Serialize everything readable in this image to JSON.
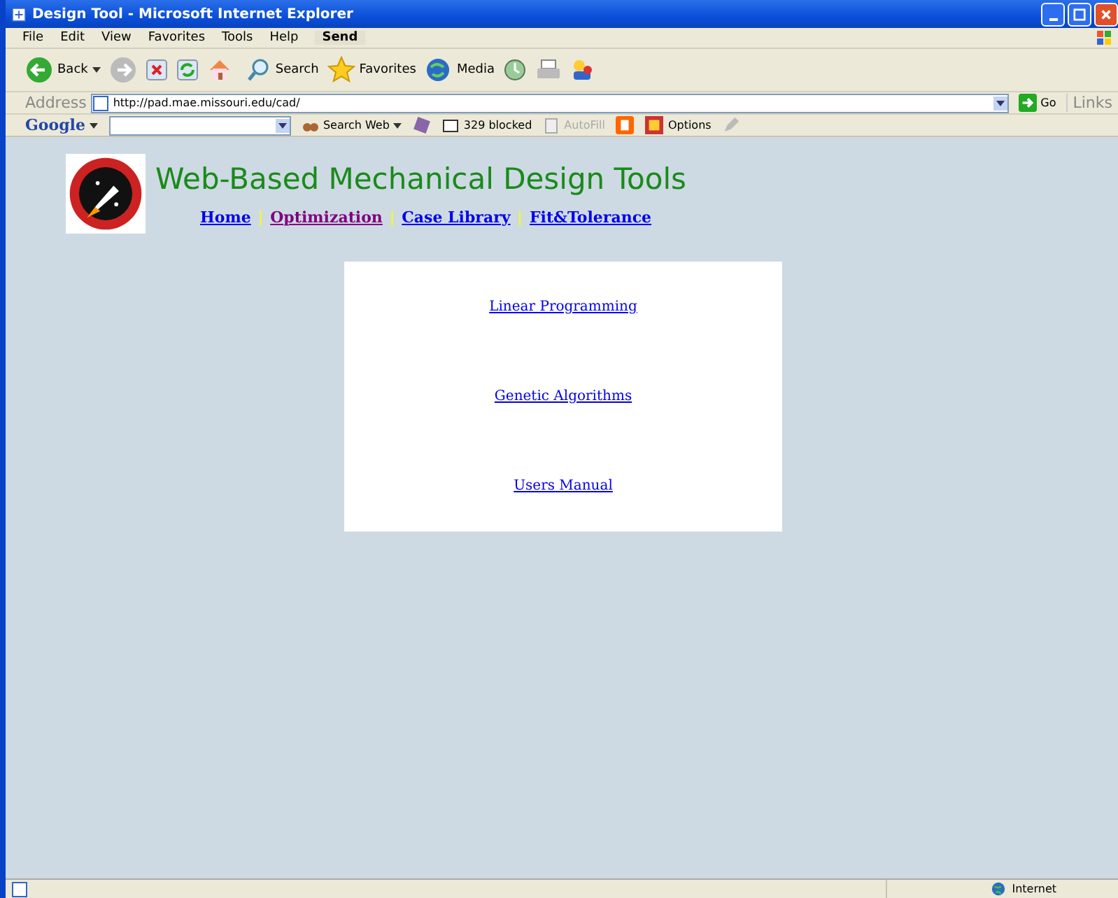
{
  "window": {
    "title": "Design Tool - Microsoft Internet Explorer"
  },
  "menu": [
    "File",
    "Edit",
    "View",
    "Favorites",
    "Tools",
    "Help"
  ],
  "send_button": "Send",
  "toolbar": [
    {
      "kind": "back",
      "label": "Back"
    },
    {
      "kind": "forward"
    },
    {
      "kind": "stop"
    },
    {
      "kind": "refresh"
    },
    {
      "kind": "home"
    },
    {
      "kind": "search",
      "label": "Search"
    },
    {
      "kind": "favorites",
      "label": "Favorites"
    },
    {
      "kind": "media",
      "label": "Media"
    },
    {
      "kind": "history"
    },
    {
      "kind": "print"
    },
    {
      "kind": "messenger"
    }
  ],
  "address": {
    "label": "Address",
    "value": "http://pad.mae.missouri.edu/cad/",
    "go": "Go",
    "links": "Links"
  },
  "google_bar": {
    "logo": "Google",
    "search_web": "Search Web",
    "blocked": "329 blocked",
    "autofill": "AutoFill",
    "options": "Options"
  },
  "page": {
    "heading": "Web-Based Mechanical Design Tools",
    "nav": [
      {
        "kind": "link",
        "label": "Home",
        "visited": false
      },
      {
        "kind": "separator",
        "label": "|"
      },
      {
        "kind": "link",
        "label": "Optimization",
        "visited": true
      },
      {
        "kind": "separator",
        "label": "|"
      },
      {
        "kind": "link",
        "label": "Case Library",
        "visited": false
      },
      {
        "kind": "separator",
        "label": "|"
      },
      {
        "kind": "link",
        "label": "Fit&Tolerance",
        "visited": false
      }
    ],
    "links": [
      "Linear Programming",
      "Genetic Algorithms",
      "Users Manual"
    ]
  },
  "status_bar": {
    "zone": "Internet"
  }
}
